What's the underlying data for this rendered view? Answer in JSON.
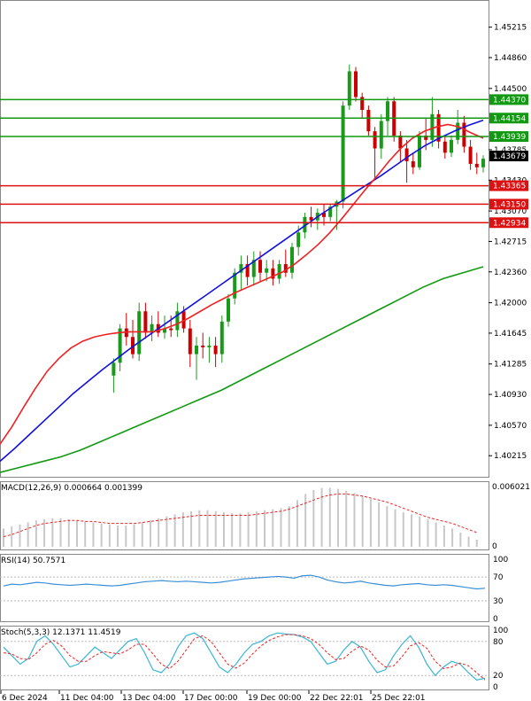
{
  "chart_data": {
    "type": "candlestick",
    "y_ticks": [
      "1.45215",
      "1.44860",
      "1.44500",
      "1.43785",
      "1.43430",
      "1.43070",
      "1.42715",
      "1.42360",
      "1.42000",
      "1.41645",
      "1.41285",
      "1.40930",
      "1.40570",
      "1.40215"
    ],
    "y_range": [
      1.4,
      1.4547
    ],
    "x_labels": [
      "6 Dec 2024",
      "11 Dec 04:00",
      "13 Dec 04:00",
      "17 Dec 00:00",
      "19 Dec 00:00",
      "22 Dec 22:01",
      "25 Dec 22:01"
    ],
    "current_price": "1.43679",
    "levels": {
      "resistance": [
        {
          "value": 1.4437,
          "label": "1.44370"
        },
        {
          "value": 1.44154,
          "label": "1.44154"
        },
        {
          "value": 1.43939,
          "label": "1.43939"
        }
      ],
      "support": [
        {
          "value": 1.43365,
          "label": "1.43365"
        },
        {
          "value": 1.4315,
          "label": "1.43150"
        },
        {
          "value": 1.42934,
          "label": "1.42934"
        }
      ]
    },
    "colors": {
      "up_candle": "#1a9a1a",
      "down_candle": "#cc0000",
      "resistance": "#119911",
      "support": "#dd1111",
      "ma_fast": "#ee2222",
      "ma_mid": "#1111dd",
      "ma_slow": "#119911",
      "macd_hist": "#c8c8c8",
      "macd_signal": "#ee2222",
      "rsi": "#3b8fd6",
      "stoch_main": "#3bb5d6",
      "stoch_signal": "#ee2222"
    },
    "candles": [
      [
        1.4115,
        1.4135,
        1.4095,
        1.413
      ],
      [
        1.413,
        1.4175,
        1.412,
        1.417
      ],
      [
        1.417,
        1.4188,
        1.415,
        1.416
      ],
      [
        1.416,
        1.418,
        1.4135,
        1.414
      ],
      [
        1.414,
        1.42,
        1.4132,
        1.419
      ],
      [
        1.419,
        1.42,
        1.4158,
        1.4165
      ],
      [
        1.4165,
        1.4185,
        1.4155,
        1.4175
      ],
      [
        1.4175,
        1.419,
        1.416,
        1.4165
      ],
      [
        1.4165,
        1.4185,
        1.4158,
        1.417
      ],
      [
        1.417,
        1.4185,
        1.416,
        1.4168
      ],
      [
        1.4168,
        1.42,
        1.416,
        1.419
      ],
      [
        1.419,
        1.4196,
        1.4165,
        1.417
      ],
      [
        1.417,
        1.418,
        1.4125,
        1.414
      ],
      [
        1.414,
        1.416,
        1.411,
        1.415
      ],
      [
        1.415,
        1.4165,
        1.4135,
        1.4148
      ],
      [
        1.4148,
        1.416,
        1.413,
        1.415
      ],
      [
        1.415,
        1.416,
        1.4125,
        1.414
      ],
      [
        1.414,
        1.4185,
        1.413,
        1.4178
      ],
      [
        1.4178,
        1.421,
        1.4172,
        1.4205
      ],
      [
        1.4205,
        1.424,
        1.4198,
        1.4235
      ],
      [
        1.4235,
        1.4255,
        1.4215,
        1.4245
      ],
      [
        1.4245,
        1.4255,
        1.422,
        1.423
      ],
      [
        1.423,
        1.426,
        1.422,
        1.425
      ],
      [
        1.425,
        1.426,
        1.4225,
        1.4235
      ],
      [
        1.4235,
        1.425,
        1.4225,
        1.424
      ],
      [
        1.424,
        1.425,
        1.422,
        1.4228
      ],
      [
        1.4228,
        1.425,
        1.4222,
        1.4245
      ],
      [
        1.4245,
        1.4262,
        1.423,
        1.4235
      ],
      [
        1.4235,
        1.427,
        1.4228,
        1.4265
      ],
      [
        1.4265,
        1.429,
        1.4255,
        1.4282
      ],
      [
        1.4282,
        1.4305,
        1.4275,
        1.43
      ],
      [
        1.43,
        1.4312,
        1.4288,
        1.4296
      ],
      [
        1.4296,
        1.431,
        1.4285,
        1.4305
      ],
      [
        1.4305,
        1.4315,
        1.429,
        1.43
      ],
      [
        1.43,
        1.4315,
        1.4295,
        1.4312
      ],
      [
        1.4312,
        1.432,
        1.4285,
        1.4318
      ],
      [
        1.4318,
        1.4435,
        1.431,
        1.443
      ],
      [
        1.443,
        1.4478,
        1.4425,
        1.447
      ],
      [
        1.447,
        1.4475,
        1.4435,
        1.444
      ],
      [
        1.444,
        1.4445,
        1.4415,
        1.4425
      ],
      [
        1.4425,
        1.443,
        1.4395,
        1.44
      ],
      [
        1.44,
        1.4405,
        1.4345,
        1.438
      ],
      [
        1.438,
        1.442,
        1.4368,
        1.4412
      ],
      [
        1.4412,
        1.444,
        1.4395,
        1.4435
      ],
      [
        1.4435,
        1.444,
        1.4388,
        1.4395
      ],
      [
        1.4395,
        1.44,
        1.4365,
        1.438
      ],
      [
        1.438,
        1.439,
        1.434,
        1.4365
      ],
      [
        1.4365,
        1.4375,
        1.435,
        1.4358
      ],
      [
        1.4358,
        1.44,
        1.4355,
        1.4395
      ],
      [
        1.4395,
        1.4415,
        1.4378,
        1.439
      ],
      [
        1.439,
        1.444,
        1.4382,
        1.442
      ],
      [
        1.442,
        1.4425,
        1.438,
        1.4388
      ],
      [
        1.4388,
        1.4395,
        1.4368,
        1.4375
      ],
      [
        1.4375,
        1.4395,
        1.437,
        1.439
      ],
      [
        1.439,
        1.4425,
        1.4385,
        1.441
      ],
      [
        1.441,
        1.4418,
        1.4375,
        1.4382
      ],
      [
        1.4382,
        1.439,
        1.4355,
        1.4362
      ],
      [
        1.4362,
        1.4375,
        1.435,
        1.4358
      ],
      [
        1.4358,
        1.4372,
        1.4352,
        1.4368
      ]
    ],
    "ma_fast": [
      1.4035,
      1.4055,
      1.4078,
      1.41,
      1.412,
      1.4135,
      1.4147,
      1.4155,
      1.416,
      1.4163,
      1.4165,
      1.4166,
      1.4166,
      1.4166,
      1.417,
      1.4175,
      1.4182,
      1.419,
      1.4198,
      1.4205,
      1.4212,
      1.4218,
      1.4224,
      1.423,
      1.4236,
      1.4245,
      1.4256,
      1.4268,
      1.4282,
      1.4298,
      1.4315,
      1.4332,
      1.4348,
      1.4365,
      1.438,
      1.4392,
      1.44,
      1.4405,
      1.4408,
      1.4405,
      1.4398,
      1.4392
    ],
    "ma_mid": [
      1.4015,
      1.403,
      1.4046,
      1.4062,
      1.4078,
      1.4094,
      1.4108,
      1.4122,
      1.4135,
      1.4148,
      1.416,
      1.4172,
      1.4184,
      1.4196,
      1.4208,
      1.422,
      1.4232,
      1.4244,
      1.4256,
      1.4268,
      1.428,
      1.4292,
      1.4304,
      1.4315,
      1.4326,
      1.4337,
      1.4348,
      1.436,
      1.4372,
      1.4383,
      1.4392,
      1.44,
      1.4407,
      1.4413
    ],
    "ma_slow": [
      1.4002,
      1.4008,
      1.4014,
      1.402,
      1.4028,
      1.4038,
      1.4048,
      1.4058,
      1.4068,
      1.4078,
      1.4088,
      1.4098,
      1.411,
      1.4122,
      1.4134,
      1.4146,
      1.4158,
      1.417,
      1.4182,
      1.4194,
      1.4206,
      1.4218,
      1.4228,
      1.4235,
      1.4242
    ],
    "macd": {
      "label": "MACD(12,26,9) 0.000664 0.001399",
      "top_value": "0.006021",
      "bottom_value": "0",
      "histogram": [
        0.0018,
        0.002,
        0.0022,
        0.0024,
        0.0026,
        0.0027,
        0.0028,
        0.0028,
        0.0027,
        0.0026,
        0.0025,
        0.0024,
        0.0023,
        0.0022,
        0.0021,
        0.0021,
        0.0022,
        0.0024,
        0.0026,
        0.0028,
        0.003,
        0.0032,
        0.0034,
        0.0035,
        0.0036,
        0.0036,
        0.0035,
        0.0034,
        0.0033,
        0.0033,
        0.0034,
        0.0035,
        0.0036,
        0.0037,
        0.0038,
        0.004,
        0.0046,
        0.0052,
        0.0056,
        0.0058,
        0.0058,
        0.0057,
        0.0055,
        0.0053,
        0.005,
        0.0047,
        0.0044,
        0.004,
        0.0037,
        0.0034,
        0.0032,
        0.003,
        0.0027,
        0.0024,
        0.0021,
        0.0018,
        0.0014,
        0.001,
        0.0007
      ],
      "signal": [
        0.001,
        0.0012,
        0.0015,
        0.0018,
        0.0021,
        0.0023,
        0.0024,
        0.0025,
        0.0026,
        0.0026,
        0.0025,
        0.0025,
        0.0024,
        0.0023,
        0.0023,
        0.0023,
        0.0023,
        0.0024,
        0.0025,
        0.0026,
        0.0027,
        0.0028,
        0.0029,
        0.003,
        0.0031,
        0.0031,
        0.0031,
        0.0031,
        0.0031,
        0.0031,
        0.0031,
        0.0032,
        0.0033,
        0.0034,
        0.0035,
        0.0037,
        0.004,
        0.0043,
        0.0046,
        0.0049,
        0.0051,
        0.0052,
        0.0052,
        0.0051,
        0.005,
        0.0048,
        0.0046,
        0.0044,
        0.0041,
        0.0038,
        0.0035,
        0.0032,
        0.0029,
        0.0027,
        0.0025,
        0.0023,
        0.002,
        0.0017,
        0.0014
      ]
    },
    "rsi": {
      "label": "RSI(14) 50.7571",
      "levels": [
        "100",
        "70",
        "30",
        "0"
      ],
      "values": [
        55,
        58,
        57,
        59,
        61,
        60,
        58,
        57,
        56,
        57,
        58,
        57,
        56,
        55,
        56,
        58,
        60,
        62,
        63,
        64,
        63,
        62,
        63,
        62,
        61,
        60,
        61,
        63,
        65,
        67,
        68,
        69,
        70,
        71,
        70,
        68,
        72,
        73,
        70,
        65,
        62,
        60,
        61,
        63,
        60,
        58,
        56,
        55,
        57,
        58,
        59,
        57,
        56,
        57,
        56,
        54,
        52,
        50,
        51
      ]
    },
    "stoch": {
      "label": "Stoch(5,3,3) 12.1371 11.4519",
      "levels": [
        "100",
        "80",
        "20",
        "0"
      ],
      "main": [
        70,
        55,
        40,
        50,
        80,
        90,
        75,
        55,
        35,
        40,
        55,
        70,
        60,
        50,
        65,
        80,
        85,
        60,
        30,
        25,
        40,
        70,
        90,
        95,
        85,
        60,
        35,
        25,
        40,
        60,
        75,
        80,
        90,
        95,
        93,
        92,
        88,
        80,
        60,
        40,
        45,
        65,
        80,
        70,
        45,
        25,
        30,
        55,
        75,
        90,
        70,
        40,
        20,
        35,
        45,
        40,
        25,
        12,
        15
      ],
      "signal": [
        60,
        58,
        50,
        48,
        60,
        75,
        82,
        72,
        55,
        45,
        45,
        55,
        62,
        60,
        58,
        65,
        75,
        75,
        58,
        40,
        32,
        45,
        65,
        85,
        90,
        80,
        60,
        40,
        33,
        42,
        58,
        72,
        82,
        88,
        92,
        92,
        90,
        85,
        75,
        60,
        48,
        50,
        63,
        72,
        65,
        47,
        35,
        37,
        53,
        72,
        78,
        68,
        45,
        32,
        35,
        42,
        37,
        25,
        12
      ]
    }
  }
}
